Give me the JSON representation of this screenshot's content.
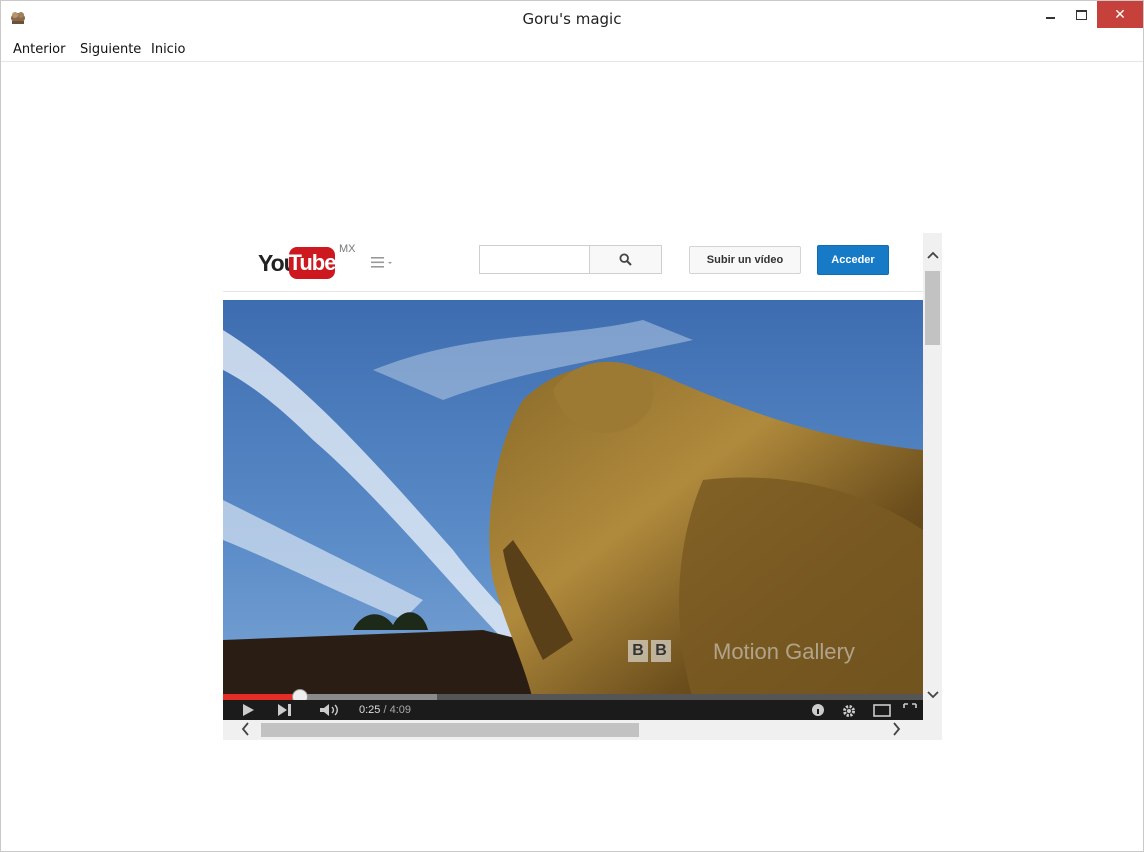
{
  "window": {
    "title": "Goru's magic",
    "controls": {
      "minimize_icon": "minimize-icon",
      "maximize_icon": "maximize-icon",
      "close_icon": "close-icon",
      "close_color": "#c7413c"
    }
  },
  "menu": {
    "items": [
      {
        "label": "Anterior"
      },
      {
        "label": "Siguiente"
      },
      {
        "label": "Inicio"
      }
    ]
  },
  "youtube": {
    "logo_you": "You",
    "logo_tube": "Tube",
    "region": "MX",
    "brand_color": "#cc181e",
    "search": {
      "placeholder": "",
      "value": "",
      "icon": "search-icon"
    },
    "upload_label": "Subir un vídeo",
    "signin_label": "Acceder",
    "signin_color": "#167ac6",
    "player": {
      "current_time": "0:25",
      "separator": " / ",
      "duration": "4:09",
      "progress_played_fraction": 0.11,
      "progress_loaded_fraction": 0.305,
      "watermark_logo": [
        "B",
        "B"
      ],
      "watermark_text": "Motion Gallery",
      "played_color": "#e52d27"
    }
  }
}
